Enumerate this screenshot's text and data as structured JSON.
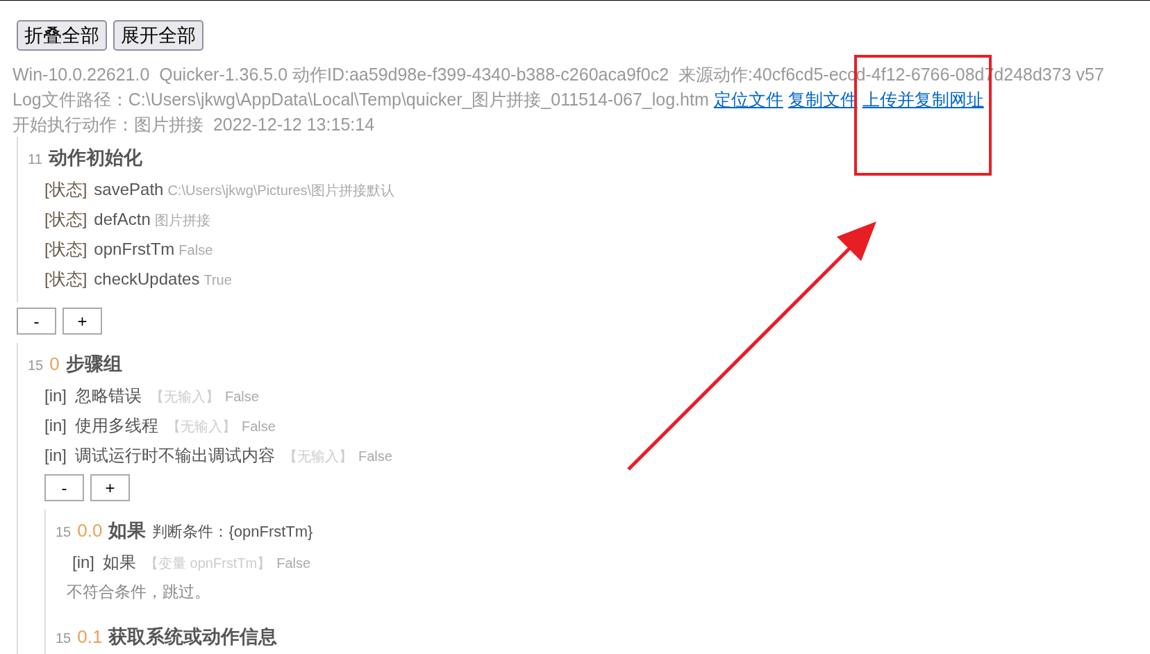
{
  "buttons": [
    "折叠全部",
    "展开全部"
  ],
  "info": {
    "line_1": "Win-10.0.22621.0  Quicker-1.36.5.0 动作ID:aa59d98e-f399-4340-b388-c260aca9f0c2  来源动作:40cf6cd5-eccd-4f12-6766-08d7d248d373 v57",
    "log_path": "Log文件路径：C:\\Users\\jkwg\\AppData\\Local\\Temp\\quicker_图片拼接_011514-067_log.htm",
    "links": [
      "定位文件",
      "复制文件",
      "上传并复制网址"
    ],
    "start": "开始执行动作：图片拼接  2022-12-12 13:15:14"
  },
  "log": [
    {
      "kind": "step",
      "line": "11",
      "title": "动作初始化",
      "params": [
        {
          "kind": "state",
          "tag": "[状态]",
          "name": "savePath",
          "value": "C:\\Users\\jkwg\\Pictures\\图片拼接默认"
        },
        {
          "kind": "state",
          "tag": "[状态]",
          "name": "defActn",
          "value": "图片拼接"
        },
        {
          "kind": "state",
          "tag": "[状态]",
          "name": "opnFrstTm",
          "value": "False"
        },
        {
          "kind": "state",
          "tag": "[状态]",
          "name": "checkUpdates",
          "value": "True"
        }
      ]
    },
    {
      "kind": "toggles",
      "labels": [
        "-",
        "+"
      ]
    },
    {
      "kind": "step",
      "line": "15",
      "index": "0",
      "title": "步骤组",
      "params": [
        {
          "kind": "in",
          "tag": "[in]",
          "name": "忽略错误",
          "hint": "【无输入】",
          "value": "False"
        },
        {
          "kind": "in",
          "tag": "[in]",
          "name": "使用多线程",
          "hint": "【无输入】",
          "value": "False"
        },
        {
          "kind": "in",
          "tag": "[in]",
          "name": "调试运行时不输出调试内容",
          "hint": "【无输入】",
          "value": "False"
        }
      ],
      "children": [
        {
          "kind": "toggles",
          "labels": [
            "-",
            "+"
          ]
        },
        {
          "kind": "step",
          "line": "15",
          "index": "0.0",
          "title": "如果",
          "condition": "判断条件：{opnFrstTm}",
          "params": [
            {
              "kind": "in",
              "tag": "[in]",
              "name": "如果",
              "hint": "【变量 opnFrstTm】",
              "value": "False"
            }
          ],
          "message": "不符合条件，跳过。"
        },
        {
          "kind": "step",
          "line": "15",
          "index": "0.1",
          "title": "获取系统或动作信息"
        }
      ]
    }
  ]
}
